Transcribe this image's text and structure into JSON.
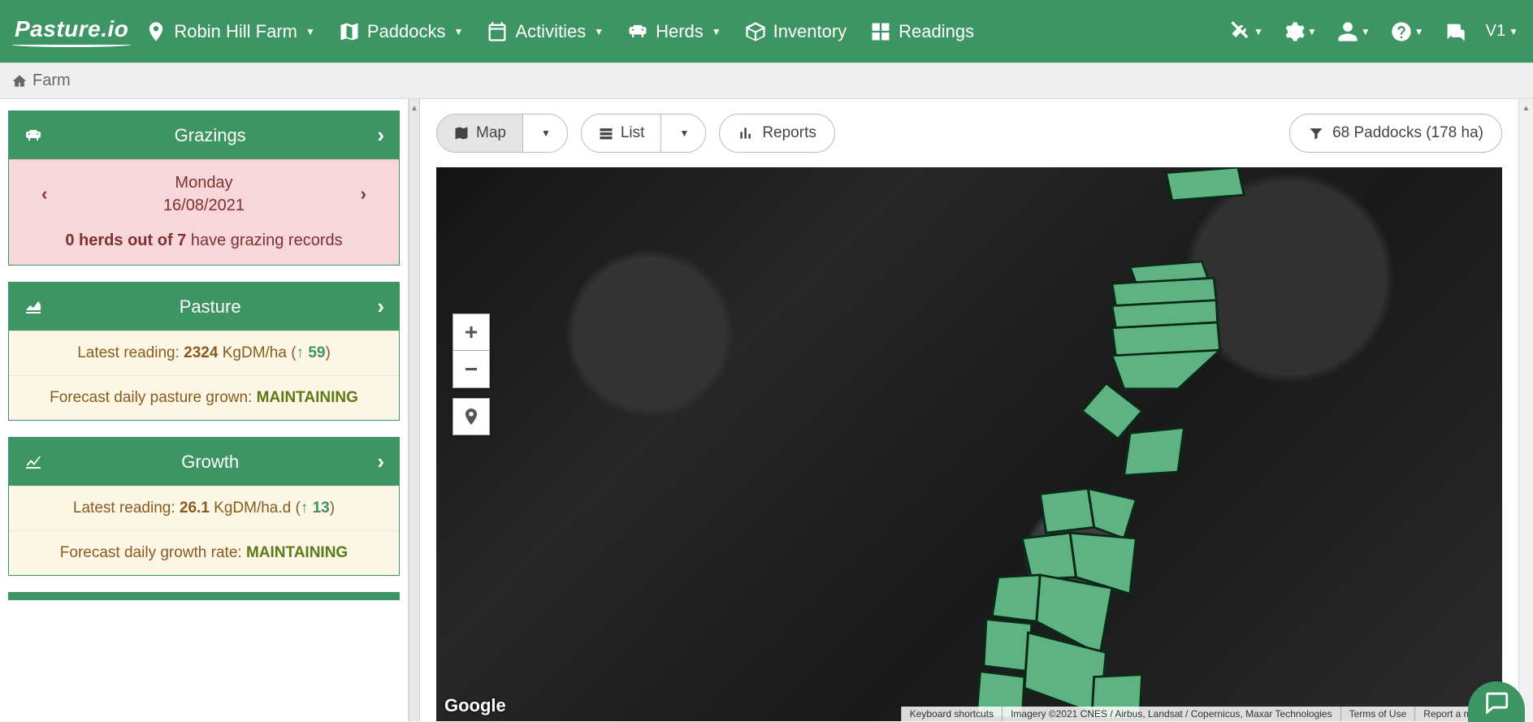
{
  "brand": "Pasture.io",
  "nav": {
    "farm": "Robin Hill Farm",
    "paddocks": "Paddocks",
    "activities": "Activities",
    "herds": "Herds",
    "inventory": "Inventory",
    "readings": "Readings",
    "version": "V1"
  },
  "breadcrumb": {
    "home": "Farm"
  },
  "grazings": {
    "title": "Grazings",
    "day": "Monday",
    "date": "16/08/2021",
    "herds_bold": "0 herds out of 7",
    "herds_rest": " have grazing records"
  },
  "pasture": {
    "title": "Pasture",
    "latest_label": "Latest reading: ",
    "latest_value": "2324",
    "latest_unit": " KgDM/ha (",
    "latest_delta": " 59",
    "latest_close": ")",
    "forecast_label": "Forecast daily pasture grown: ",
    "forecast_value": "MAINTAINING"
  },
  "growth": {
    "title": "Growth",
    "latest_label": "Latest reading: ",
    "latest_value": "26.1",
    "latest_unit": " KgDM/ha.d (",
    "latest_delta": " 13",
    "latest_close": ")",
    "forecast_label": "Forecast daily growth rate: ",
    "forecast_value": "MAINTAINING"
  },
  "toolbar": {
    "map": "Map",
    "list": "List",
    "reports": "Reports",
    "filter": "68 Paddocks (178 ha)"
  },
  "map": {
    "attribution_shortcuts": "Keyboard shortcuts",
    "attribution_imagery": "Imagery ©2021 CNES / Airbus, Landsat / Copernicus, Maxar Technologies",
    "attribution_terms": "Terms of Use",
    "attribution_report": "Report a map er",
    "google": "Google"
  }
}
